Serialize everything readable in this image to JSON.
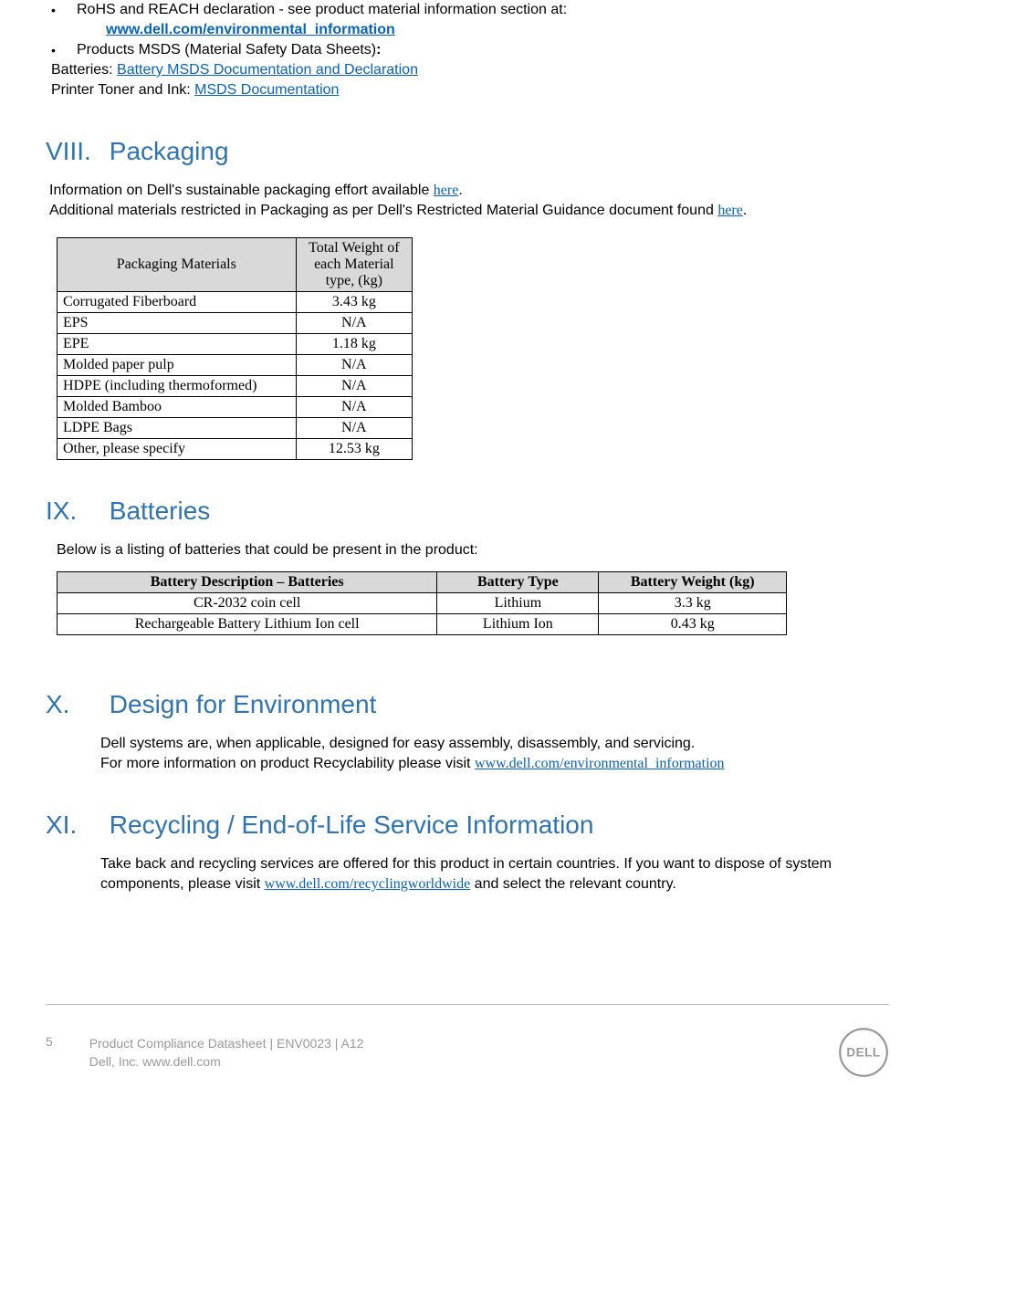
{
  "top": {
    "bullet1_text": "RoHS and REACH declaration - see product material information section at:",
    "bullet1_link": "www.dell.com/environmental_information",
    "bullet2_text": "Products MSDS (Material Safety Data Sheets)",
    "bullet2_colon": ":",
    "batteries_label": "Batteries: ",
    "batteries_link": "Battery MSDS Documentation and Declaration",
    "toner_label": "Printer Toner and Ink:   ",
    "toner_link": "MSDS Documentation"
  },
  "s8": {
    "roman": "VIII.",
    "title": "Packaging",
    "p1_a": "Information on Dell's sustainable packaging effort available ",
    "p1_link": "here",
    "p1_b": ".",
    "p2_a": "Additional materials restricted in Packaging as per Dell's Restricted Material Guidance document found ",
    "p2_link": "here",
    "p2_b": "."
  },
  "packaging_table": {
    "h1": "Packaging Materials",
    "h2": "Total Weight of each Material type, (kg)",
    "rows": [
      {
        "m": "Corrugated Fiberboard",
        "w": "3.43 kg"
      },
      {
        "m": "EPS",
        "w": "N/A"
      },
      {
        "m": "EPE",
        "w": "1.18 kg"
      },
      {
        "m": "Molded paper pulp",
        "w": "N/A"
      },
      {
        "m": "HDPE (including thermoformed)",
        "w": "N/A"
      },
      {
        "m": "Molded Bamboo",
        "w": "N/A"
      },
      {
        "m": "LDPE Bags",
        "w": "N/A"
      },
      {
        "m": "Other, please specify",
        "w": "12.53 kg"
      }
    ]
  },
  "s9": {
    "roman": "IX.",
    "title": "Batteries",
    "intro": "Below is a listing of batteries that could be present in the product:"
  },
  "battery_table": {
    "h1": "Battery Description – Batteries",
    "h2": "Battery Type",
    "h3": "Battery Weight (kg)",
    "rows": [
      {
        "d": "CR-2032 coin cell",
        "t": "Lithium",
        "w": "3.3 kg"
      },
      {
        "d": "Rechargeable Battery Lithium Ion cell",
        "t": "Lithium Ion",
        "w": "0.43 kg"
      }
    ]
  },
  "s10": {
    "roman": "X.",
    "title": "Design for Environment",
    "p1": "Dell systems are, when applicable, designed for easy assembly, disassembly, and servicing.",
    "p2_a": "For more information on product Recyclability please visit ",
    "p2_link": "www.dell.com/environmental_information"
  },
  "s11": {
    "roman": "XI.",
    "title": "Recycling / End-of-Life Service Information",
    "p_a": "Take back and recycling services are offered for this product in certain countries. If you want to dispose of system components,  please visit ",
    "p_link": "www.dell.com/recyclingworldwide",
    "p_b": " and select the relevant country."
  },
  "footer": {
    "page": "5",
    "line1": "Product Compliance Datasheet | ENV0023 | A12",
    "line2a": "Dell, Inc.  ",
    "line2b": "www.dell.com"
  }
}
